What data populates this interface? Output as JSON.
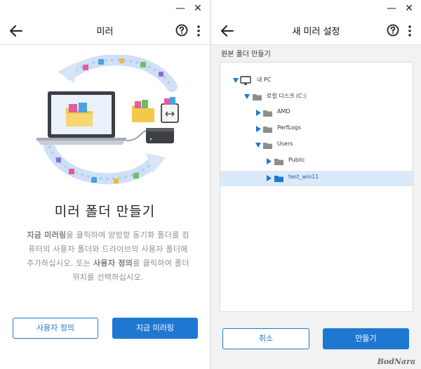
{
  "left": {
    "title": "미러",
    "heading": "미러 폴더 만들기",
    "desc": {
      "b1": "지금 미러링",
      "t1": "을 클릭하여 양방향 동기화 폴더를 컴퓨터의 사용자 폴더와 드라이브의 사용자 폴더에 추가하십시오. 또는 ",
      "b2": "사용자 정의",
      "t2": "를 클릭하여 폴더 위치를 선택하십시오."
    },
    "custom_button": "사용자 정의",
    "mirror_now_button": "지금 미러링"
  },
  "right": {
    "title": "새 미러 설정",
    "section_label": "원본 폴더 만들기",
    "tree": [
      {
        "label": "내 PC",
        "icon": "monitor-icon",
        "expanded": true
      },
      {
        "label": "로컬 디스크 (C:)",
        "icon": "drive-icon",
        "expanded": true
      },
      {
        "label": "AMD",
        "icon": "folder-icon",
        "expanded": false
      },
      {
        "label": "PerfLogs",
        "icon": "folder-icon",
        "expanded": false
      },
      {
        "label": "Users",
        "icon": "folder-icon",
        "expanded": true
      },
      {
        "label": "Public",
        "icon": "folder-icon",
        "expanded": false
      },
      {
        "label": "test_win11",
        "icon": "folder-icon",
        "expanded": false,
        "selected": true
      }
    ],
    "cancel_button": "취소",
    "create_button": "만들기"
  },
  "window": {
    "minimize": "—",
    "close": "✕"
  },
  "watermark": "BodNara",
  "colors": {
    "accent": "#1e78d2",
    "selection": "#dbeaf9",
    "folder": "#8d8d8d"
  }
}
